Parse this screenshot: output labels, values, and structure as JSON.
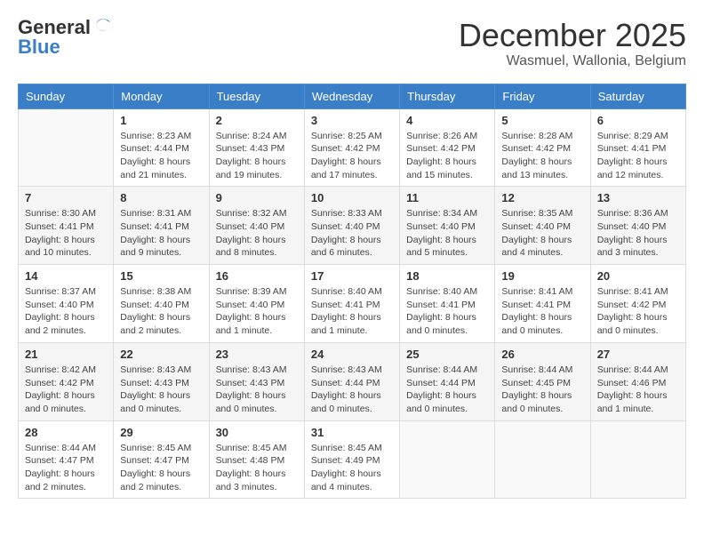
{
  "logo": {
    "general": "General",
    "blue": "Blue"
  },
  "title": "December 2025",
  "subtitle": "Wasmuel, Wallonia, Belgium",
  "days": [
    "Sunday",
    "Monday",
    "Tuesday",
    "Wednesday",
    "Thursday",
    "Friday",
    "Saturday"
  ],
  "weeks": [
    [
      {
        "day": "",
        "sunrise": "",
        "sunset": "",
        "daylight": ""
      },
      {
        "day": "1",
        "sunrise": "8:23 AM",
        "sunset": "4:44 PM",
        "daylight": "8 hours and 21 minutes."
      },
      {
        "day": "2",
        "sunrise": "8:24 AM",
        "sunset": "4:43 PM",
        "daylight": "8 hours and 19 minutes."
      },
      {
        "day": "3",
        "sunrise": "8:25 AM",
        "sunset": "4:42 PM",
        "daylight": "8 hours and 17 minutes."
      },
      {
        "day": "4",
        "sunrise": "8:26 AM",
        "sunset": "4:42 PM",
        "daylight": "8 hours and 15 minutes."
      },
      {
        "day": "5",
        "sunrise": "8:28 AM",
        "sunset": "4:42 PM",
        "daylight": "8 hours and 13 minutes."
      },
      {
        "day": "6",
        "sunrise": "8:29 AM",
        "sunset": "4:41 PM",
        "daylight": "8 hours and 12 minutes."
      }
    ],
    [
      {
        "day": "7",
        "sunrise": "8:30 AM",
        "sunset": "4:41 PM",
        "daylight": "8 hours and 10 minutes."
      },
      {
        "day": "8",
        "sunrise": "8:31 AM",
        "sunset": "4:41 PM",
        "daylight": "8 hours and 9 minutes."
      },
      {
        "day": "9",
        "sunrise": "8:32 AM",
        "sunset": "4:40 PM",
        "daylight": "8 hours and 8 minutes."
      },
      {
        "day": "10",
        "sunrise": "8:33 AM",
        "sunset": "4:40 PM",
        "daylight": "8 hours and 6 minutes."
      },
      {
        "day": "11",
        "sunrise": "8:34 AM",
        "sunset": "4:40 PM",
        "daylight": "8 hours and 5 minutes."
      },
      {
        "day": "12",
        "sunrise": "8:35 AM",
        "sunset": "4:40 PM",
        "daylight": "8 hours and 4 minutes."
      },
      {
        "day": "13",
        "sunrise": "8:36 AM",
        "sunset": "4:40 PM",
        "daylight": "8 hours and 3 minutes."
      }
    ],
    [
      {
        "day": "14",
        "sunrise": "8:37 AM",
        "sunset": "4:40 PM",
        "daylight": "8 hours and 2 minutes."
      },
      {
        "day": "15",
        "sunrise": "8:38 AM",
        "sunset": "4:40 PM",
        "daylight": "8 hours and 2 minutes."
      },
      {
        "day": "16",
        "sunrise": "8:39 AM",
        "sunset": "4:40 PM",
        "daylight": "8 hours and 1 minute."
      },
      {
        "day": "17",
        "sunrise": "8:40 AM",
        "sunset": "4:41 PM",
        "daylight": "8 hours and 1 minute."
      },
      {
        "day": "18",
        "sunrise": "8:40 AM",
        "sunset": "4:41 PM",
        "daylight": "8 hours and 0 minutes."
      },
      {
        "day": "19",
        "sunrise": "8:41 AM",
        "sunset": "4:41 PM",
        "daylight": "8 hours and 0 minutes."
      },
      {
        "day": "20",
        "sunrise": "8:41 AM",
        "sunset": "4:42 PM",
        "daylight": "8 hours and 0 minutes."
      }
    ],
    [
      {
        "day": "21",
        "sunrise": "8:42 AM",
        "sunset": "4:42 PM",
        "daylight": "8 hours and 0 minutes."
      },
      {
        "day": "22",
        "sunrise": "8:43 AM",
        "sunset": "4:43 PM",
        "daylight": "8 hours and 0 minutes."
      },
      {
        "day": "23",
        "sunrise": "8:43 AM",
        "sunset": "4:43 PM",
        "daylight": "8 hours and 0 minutes."
      },
      {
        "day": "24",
        "sunrise": "8:43 AM",
        "sunset": "4:44 PM",
        "daylight": "8 hours and 0 minutes."
      },
      {
        "day": "25",
        "sunrise": "8:44 AM",
        "sunset": "4:44 PM",
        "daylight": "8 hours and 0 minutes."
      },
      {
        "day": "26",
        "sunrise": "8:44 AM",
        "sunset": "4:45 PM",
        "daylight": "8 hours and 0 minutes."
      },
      {
        "day": "27",
        "sunrise": "8:44 AM",
        "sunset": "4:46 PM",
        "daylight": "8 hours and 1 minute."
      }
    ],
    [
      {
        "day": "28",
        "sunrise": "8:44 AM",
        "sunset": "4:47 PM",
        "daylight": "8 hours and 2 minutes."
      },
      {
        "day": "29",
        "sunrise": "8:45 AM",
        "sunset": "4:47 PM",
        "daylight": "8 hours and 2 minutes."
      },
      {
        "day": "30",
        "sunrise": "8:45 AM",
        "sunset": "4:48 PM",
        "daylight": "8 hours and 3 minutes."
      },
      {
        "day": "31",
        "sunrise": "8:45 AM",
        "sunset": "4:49 PM",
        "daylight": "8 hours and 4 minutes."
      },
      {
        "day": "",
        "sunrise": "",
        "sunset": "",
        "daylight": ""
      },
      {
        "day": "",
        "sunrise": "",
        "sunset": "",
        "daylight": ""
      },
      {
        "day": "",
        "sunrise": "",
        "sunset": "",
        "daylight": ""
      }
    ]
  ],
  "labels": {
    "sunrise_prefix": "Sunrise: ",
    "sunset_prefix": "Sunset: ",
    "daylight_prefix": "Daylight: "
  }
}
